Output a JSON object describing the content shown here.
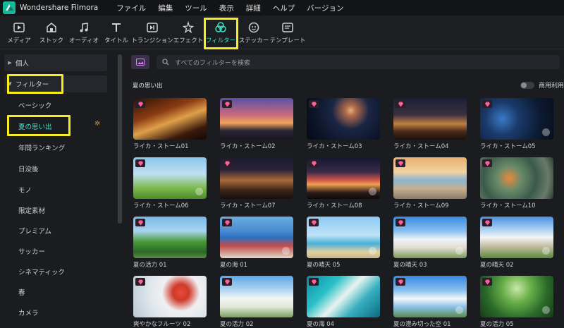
{
  "app": {
    "title": "Wondershare Filmora"
  },
  "menu": [
    "ファイル",
    "編集",
    "ツール",
    "表示",
    "詳細",
    "ヘルプ",
    "バージョン"
  ],
  "toolbar": [
    {
      "label": "メディア",
      "icon": "media-icon"
    },
    {
      "label": "ストック",
      "icon": "stock-icon"
    },
    {
      "label": "オーディオ",
      "icon": "audio-icon"
    },
    {
      "label": "タイトル",
      "icon": "title-icon"
    },
    {
      "label": "トランジション",
      "icon": "transition-icon"
    },
    {
      "label": "エフェクト",
      "icon": "effect-icon"
    },
    {
      "label": "フィルター",
      "icon": "filter-icon",
      "active": true
    },
    {
      "label": "ステッカー",
      "icon": "sticker-icon"
    },
    {
      "label": "テンプレート",
      "icon": "template-icon"
    }
  ],
  "sidebar": {
    "groups": [
      {
        "label": "個人",
        "expanded": false
      },
      {
        "label": "フィルター",
        "expanded": true
      }
    ],
    "items": [
      "ベーシック",
      "夏の思い出",
      "年間ランキング",
      "日没後",
      "モノ",
      "限定素材",
      "プレミアム",
      "サッカー",
      "シネマティック",
      "春",
      "カメラ"
    ],
    "selected": "夏の思い出"
  },
  "search": {
    "placeholder": "すべてのフィルターを検索"
  },
  "section": {
    "title": "夏の思い出",
    "commercial_label": "商用利用"
  },
  "cards": [
    {
      "label": "ライカ・ストーム01"
    },
    {
      "label": "ライカ・ストーム02"
    },
    {
      "label": "ライカ・ストーム03"
    },
    {
      "label": "ライカ・ストーム04"
    },
    {
      "label": "ライカ・ストーム05"
    },
    {
      "label": "ライカ・ストーム06"
    },
    {
      "label": "ライカ・ストーム07"
    },
    {
      "label": "ライカ・ストーム08"
    },
    {
      "label": "ライカ・ストーム09"
    },
    {
      "label": "ライカ・ストーム10"
    },
    {
      "label": "夏の活力 01"
    },
    {
      "label": "夏の海 01"
    },
    {
      "label": "夏の晴天 05"
    },
    {
      "label": "夏の晴天 03"
    },
    {
      "label": "夏の晴天 02"
    },
    {
      "label": "爽やかなフルーツ 02"
    },
    {
      "label": "夏の活力 02"
    },
    {
      "label": "夏の海 04"
    },
    {
      "label": "夏の澄み切った空 01"
    },
    {
      "label": "夏の活力 05"
    }
  ],
  "colors": {
    "accent": "#38e0c4",
    "highlight": "#f5ee1c",
    "premium_gem": "#ff5fa0"
  }
}
